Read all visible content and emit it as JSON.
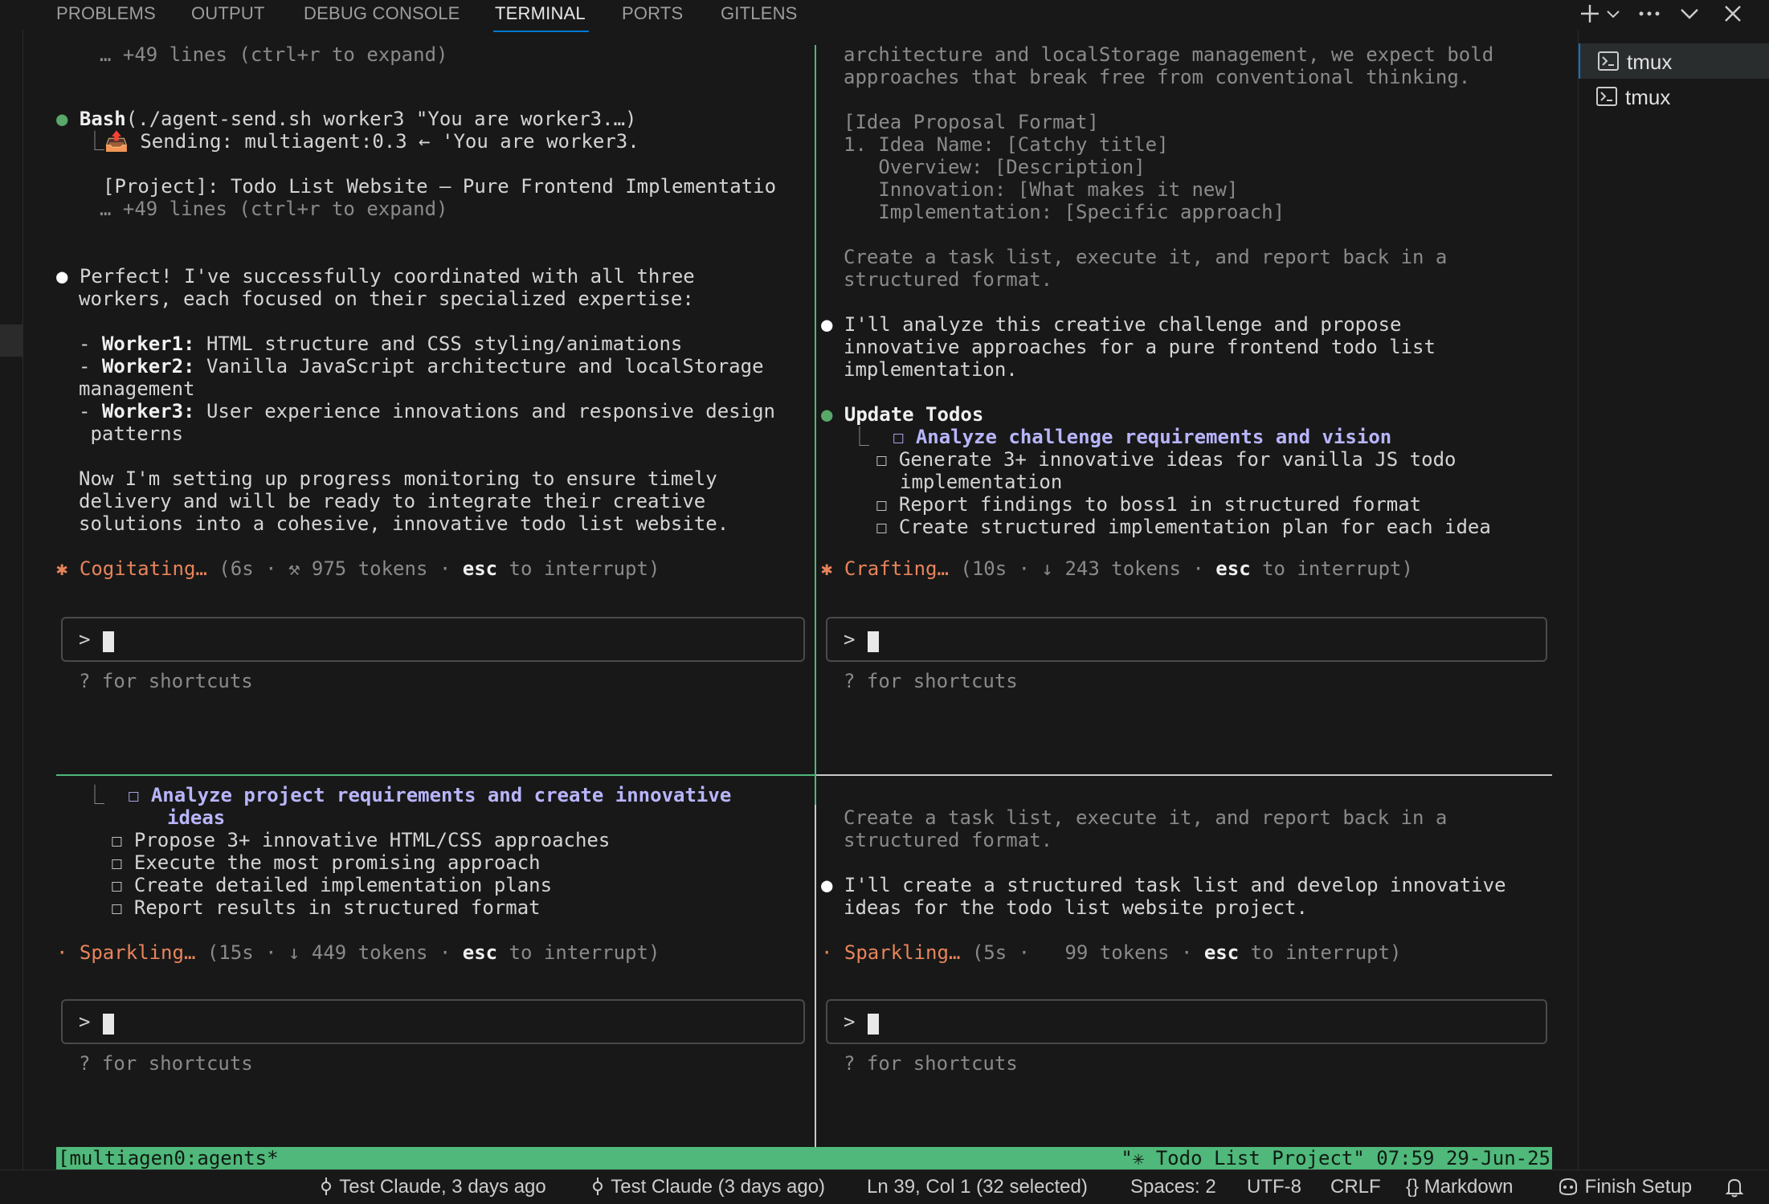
{
  "panel_tabs": [
    "PROBLEMS",
    "OUTPUT",
    "DEBUG CONSOLE",
    "TERMINAL",
    "PORTS",
    "GITLENS"
  ],
  "active_tab": "TERMINAL",
  "toolbar_icons": [
    "plus-icon",
    "chevron-down-icon",
    "ellipsis-icon",
    "chevron-down-icon",
    "close-icon"
  ],
  "terminal_list": [
    {
      "label": "tmux",
      "selected": true
    },
    {
      "label": "tmux",
      "selected": false
    }
  ],
  "pane_tl": {
    "expand1": "… +49 lines (ctrl+r to expand)",
    "bash_cmd_bold": "Bash",
    "bash_cmd_rest": "(./agent-send.sh worker3 \"You are worker3.…)",
    "sending": "Sending: multiagent:0.3 ← 'You are worker3.",
    "project": "[Project]: Todo List Website – Pure Frontend Implementatio",
    "expand2": "… +49 lines (ctrl+r to expand)",
    "perfect1": "Perfect! I've successfully coordinated with all three",
    "perfect2": "workers, each focused on their specialized expertise:",
    "w1_bold": "Worker1:",
    "w1_rest": " HTML structure and CSS styling/animations",
    "w2_bold": "Worker2:",
    "w2_rest": " Vanilla JavaScript architecture and localStorage",
    "w2_cont": "management",
    "w3_bold": "Worker3:",
    "w3_rest": " User experience innovations and responsive design",
    "w3_cont": " patterns",
    "now1": "Now I'm setting up progress monitoring to ensure timely",
    "now2": "delivery and will be ready to integrate their creative",
    "now3": "solutions into a cohesive, innovative todo list website.",
    "status_word": "Cogitating…",
    "status_rest": " (6s · ⚒ 975 tokens · ",
    "esc": "esc",
    "interrupt": " to interrupt)",
    "prompt": ">",
    "shortcuts": "? for shortcuts"
  },
  "pane_tr": {
    "l1": "architecture and localStorage management, we expect bold",
    "l2": "approaches that break free from conventional thinking.",
    "l3": "[Idea Proposal Format]",
    "l4": "1. Idea Name: [Catchy title]",
    "l5": "   Overview: [Description]",
    "l6": "   Innovation: [What makes it new]",
    "l7": "   Implementation: [Specific approach]",
    "l8": "Create a task list, execute it, and report back in a",
    "l9": "structured format.",
    "a1": "I'll analyze this creative challenge and propose",
    "a2": "innovative approaches for a pure frontend todo list",
    "a3": "implementation.",
    "update": "Update Todos",
    "t1": "Analyze challenge requirements and vision",
    "t2": "Generate 3+ innovative ideas for vanilla JS todo",
    "t2b": "implementation",
    "t3": "Report findings to boss1 in structured format",
    "t4": "Create structured implementation plan for each idea",
    "status_word": "Crafting…",
    "status_rest": " (10s · ↓ 243 tokens · ",
    "esc": "esc",
    "interrupt": " to interrupt)",
    "prompt": ">",
    "shortcuts": "? for shortcuts"
  },
  "pane_bl": {
    "t1": "Analyze project requirements and create innovative",
    "t1b": "ideas",
    "t2": "Propose 3+ innovative HTML/CSS approaches",
    "t3": "Execute the most promising approach",
    "t4": "Create detailed implementation plans",
    "t5": "Report results in structured format",
    "status_word": "Sparkling…",
    "status_rest": " (15s · ↓ 449 tokens · ",
    "esc": "esc",
    "interrupt": " to interrupt)",
    "prompt": ">",
    "shortcuts": "? for shortcuts"
  },
  "pane_br": {
    "l1": "Create a task list, execute it, and report back in a",
    "l2": "structured format.",
    "a1": "I'll create a structured task list and develop innovative",
    "a2": "ideas for the todo list website project.",
    "status_word": "Sparkling…",
    "status_rest": " (5s ·   99 tokens · ",
    "esc": "esc",
    "interrupt": " to interrupt)",
    "prompt": ">",
    "shortcuts": "? for shortcuts"
  },
  "tmux_status": {
    "left": "[multiagen0:agents*",
    "right": "\"✳ Todo List Project\" 07:59 29-Jun-25"
  },
  "statusbar": {
    "blame1": "Test Claude, 3 days ago",
    "blame2": "Test Claude (3 days ago)",
    "position": "Ln 39, Col 1 (32 selected)",
    "spaces": "Spaces: 2",
    "encoding": "UTF-8",
    "eol": "CRLF",
    "language": "Markdown",
    "finish": "Finish Setup"
  },
  "colors": {
    "background": "#181818",
    "tmux_green": "#4fb87a",
    "todo_purple": "#b8b5fb",
    "status_orange": "#e8845b",
    "tab_accent": "#0078d4"
  }
}
